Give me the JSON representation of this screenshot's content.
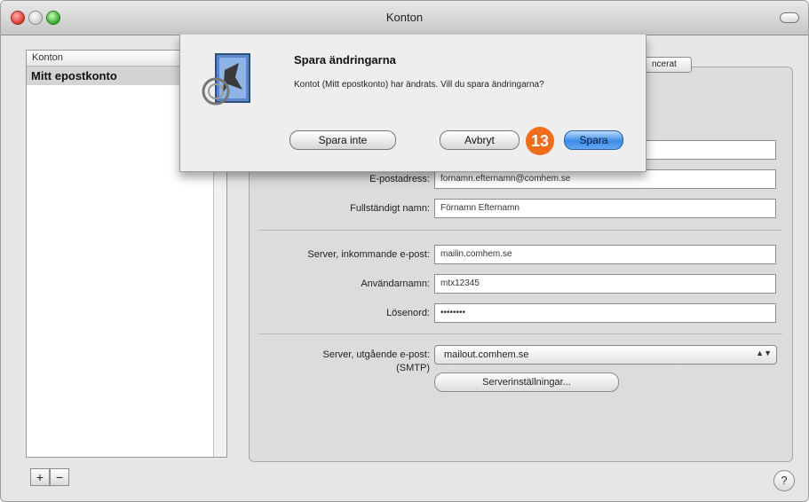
{
  "window": {
    "title": "Konton"
  },
  "accounts_list": {
    "header": "Konton",
    "items": [
      "Mitt epostkonto"
    ]
  },
  "tab_partial_label": "ncerat",
  "form": {
    "email_label": "E-postadress:",
    "email_value": "fornamn.efternamn@comhem.se",
    "fullname_label": "Fullständigt namn:",
    "fullname_value": "Förnamn Efternamn",
    "incoming_label": "Server, inkommande e-post:",
    "incoming_value": "mailin.comhem.se",
    "username_label": "Användarnamn:",
    "username_value": "mtx12345",
    "password_label": "Lösenord:",
    "password_value": "••••••••",
    "outgoing_label": "Server, utgående e-post:",
    "outgoing_label_sub": "(SMTP)",
    "outgoing_value": "mailout.comhem.se",
    "server_settings_button": "Serverinställningar..."
  },
  "controls": {
    "add": "+",
    "remove": "−",
    "help": "?"
  },
  "sheet": {
    "title": "Spara ändringarna",
    "message": "Kontot (Mitt epostkonto) har ändrats. Vill du spara ändringarna?",
    "dont_save": "Spara inte",
    "cancel": "Avbryt",
    "save": "Spara"
  },
  "step_badge": "13",
  "colors": {
    "badge": "#ef6d1b",
    "default_button": "#3d8be6"
  }
}
